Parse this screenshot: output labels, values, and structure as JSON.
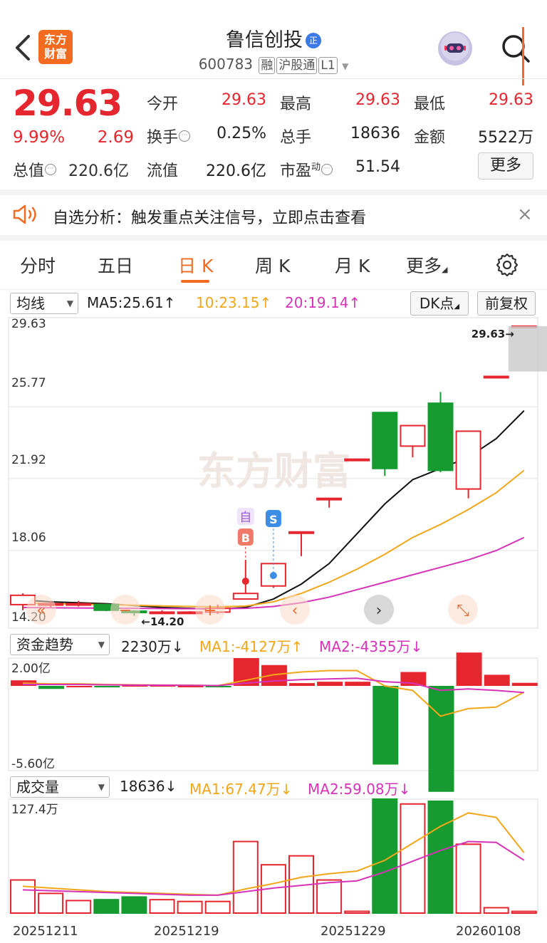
{
  "header": {
    "logo_text_1": "东方",
    "logo_text_2": "财富",
    "stock_name": "鲁信创投",
    "stock_badge": "正",
    "stock_code": "600783",
    "tags": [
      "融",
      "沪股通",
      "L1"
    ]
  },
  "quote": {
    "price": "29.63",
    "change_pct": "9.99%",
    "change": "2.69",
    "total_value_label": "总值",
    "total_value": "220.6亿",
    "fields": [
      {
        "label": "今开",
        "value": "29.63",
        "color": "red"
      },
      {
        "label": "最高",
        "value": "29.63",
        "color": "red"
      },
      {
        "label": "最低",
        "value": "29.63",
        "color": "red"
      },
      {
        "label": "换手",
        "value": "0.25%",
        "color": "dark",
        "info": true
      },
      {
        "label": "总手",
        "value": "18636",
        "color": "dark"
      },
      {
        "label": "金额",
        "value": "5522万",
        "color": "dark"
      },
      {
        "label": "流值",
        "value": "220.6亿",
        "color": "dark"
      },
      {
        "label": "市盈",
        "sup": "动",
        "value": "51.54",
        "color": "dark",
        "info": true
      }
    ],
    "more_button": "更多"
  },
  "banner": {
    "text": "自选分析：触发重点关注信号，立即点击查看",
    "close": "×"
  },
  "tabs": [
    "分时",
    "五日",
    "日 K",
    "周 K",
    "月 K",
    "更多"
  ],
  "kline_controls": {
    "indicator_select": "均线",
    "ma5": "MA5:25.61↑",
    "ma10": "10:23.15↑",
    "ma20": "20:19.14↑",
    "dk_button": "DK点",
    "fq_button": "前复权"
  },
  "fund_controls": {
    "indicator_select": "资金趋势",
    "value": "2230万↓",
    "ma1": "MA1:-4127万↑",
    "ma2": "MA2:-4355万↓"
  },
  "volume_controls": {
    "indicator_select": "成交量",
    "value": "18636↓",
    "ma1": "MA1:67.47万↓",
    "ma2": "MA2:59.08万↓"
  },
  "colors": {
    "up": "#e6262e",
    "down": "#159b2f",
    "accent": "#f26b21",
    "ma5": "#111111",
    "ma10": "#f2a71b",
    "ma20": "#d633b8"
  },
  "chart_data": [
    {
      "type": "candlestick",
      "y_tick_labels": [
        "29.63",
        "25.77",
        "21.92",
        "18.06",
        "14.20"
      ],
      "ylim": [
        14.2,
        29.63
      ],
      "max_marker": "29.63→",
      "min_marker": "←14.20",
      "signal_labels": [
        "自",
        "B",
        "S"
      ],
      "watermark": "东方财富",
      "candles": [
        {
          "o": 14.7,
          "h": 15.3,
          "l": 14.4,
          "c": 15.2
        },
        {
          "o": 14.75,
          "h": 14.9,
          "l": 14.55,
          "c": 14.75
        },
        {
          "o": 14.75,
          "h": 14.9,
          "l": 14.6,
          "c": 14.75
        },
        {
          "o": 14.7,
          "h": 14.75,
          "l": 14.35,
          "c": 14.4
        },
        {
          "o": 14.35,
          "h": 14.4,
          "l": 14.1,
          "c": 14.3
        },
        {
          "o": 14.3,
          "h": 14.4,
          "l": 14.2,
          "c": 14.3
        },
        {
          "o": 14.3,
          "h": 14.35,
          "l": 14.2,
          "c": 14.3
        },
        {
          "o": 14.3,
          "h": 14.7,
          "l": 14.2,
          "c": 14.5
        },
        {
          "o": 15.0,
          "h": 17.1,
          "l": 15.0,
          "c": 15.3
        },
        {
          "o": 15.7,
          "h": 16.9,
          "l": 15.6,
          "c": 16.9
        },
        {
          "o": 18.6,
          "h": 18.6,
          "l": 17.3,
          "c": 18.6
        },
        {
          "o": 20.4,
          "h": 20.4,
          "l": 19.9,
          "c": 20.4
        },
        {
          "o": 22.5,
          "h": 22.5,
          "l": 22.5,
          "c": 22.5
        },
        {
          "o": 25.0,
          "h": 25.0,
          "l": 21.6,
          "c": 22.0
        },
        {
          "o": 23.2,
          "h": 24.3,
          "l": 22.6,
          "c": 24.3
        },
        {
          "o": 25.5,
          "h": 26.1,
          "l": 21.8,
          "c": 21.9
        },
        {
          "o": 20.9,
          "h": 24.0,
          "l": 20.4,
          "c": 24.0
        },
        {
          "o": 26.94,
          "h": 26.94,
          "l": 26.94,
          "c": 26.94
        },
        {
          "o": 29.63,
          "h": 29.63,
          "l": 29.63,
          "c": 29.63
        }
      ],
      "ma5": [
        14.95,
        14.85,
        14.8,
        14.75,
        14.65,
        14.55,
        14.5,
        14.45,
        14.55,
        15.0,
        15.8,
        16.9,
        18.5,
        20.1,
        21.4,
        22.0,
        22.6,
        23.6,
        25.1
      ],
      "ma10": [
        14.8,
        14.75,
        14.72,
        14.7,
        14.67,
        14.63,
        14.6,
        14.58,
        14.62,
        14.85,
        15.3,
        15.9,
        16.6,
        17.4,
        18.3,
        19.0,
        19.8,
        20.7,
        21.9
      ],
      "ma20": [
        14.55,
        14.53,
        14.52,
        14.51,
        14.5,
        14.49,
        14.48,
        14.48,
        14.5,
        14.6,
        14.8,
        15.1,
        15.5,
        15.9,
        16.3,
        16.7,
        17.1,
        17.6,
        18.3
      ]
    },
    {
      "type": "bar",
      "y_tick_labels": [
        "2.00亿",
        "-5.60亿"
      ],
      "ylim": [
        -5.6,
        2.0
      ],
      "values": [
        0.4,
        -0.2,
        0.0,
        -0.1,
        0.05,
        0.05,
        0.0,
        -0.05,
        2.0,
        1.5,
        0.2,
        0.3,
        0.3,
        -5.2,
        1.0,
        -7.0,
        2.4,
        0.8,
        0.22
      ],
      "ma1": [
        0.2,
        0.15,
        0.15,
        0.1,
        0.08,
        0.06,
        0.05,
        0.02,
        0.4,
        0.8,
        1.0,
        1.1,
        1.1,
        0.0,
        -0.3,
        -2.0,
        -1.5,
        -1.4,
        -0.41
      ],
      "ma2": [
        0.1,
        0.1,
        0.1,
        0.08,
        0.06,
        0.05,
        0.04,
        0.02,
        0.2,
        0.35,
        0.45,
        0.5,
        0.55,
        0.3,
        0.2,
        -0.3,
        -0.2,
        -0.3,
        -0.44
      ]
    },
    {
      "type": "bar",
      "y_tick_labels": [
        "127.4万"
      ],
      "ylim": [
        0,
        127.4
      ],
      "values": [
        37,
        22,
        14,
        15,
        18,
        15,
        13,
        13,
        80,
        54,
        64,
        37,
        2,
        127.4,
        122,
        125,
        77,
        6,
        1.9
      ],
      "ma1": [
        30,
        28,
        26,
        24,
        23,
        22,
        21,
        20,
        27,
        33,
        40,
        44,
        47,
        59,
        78,
        97,
        112,
        107,
        67.47
      ],
      "ma2": [
        26,
        25,
        24,
        23,
        22,
        21,
        20,
        20,
        24,
        28,
        31,
        34,
        36,
        46,
        58,
        70,
        80,
        79,
        59.08
      ],
      "x_tick_labels": [
        "20251211",
        "20251219",
        "20251229",
        "20260108"
      ]
    }
  ]
}
